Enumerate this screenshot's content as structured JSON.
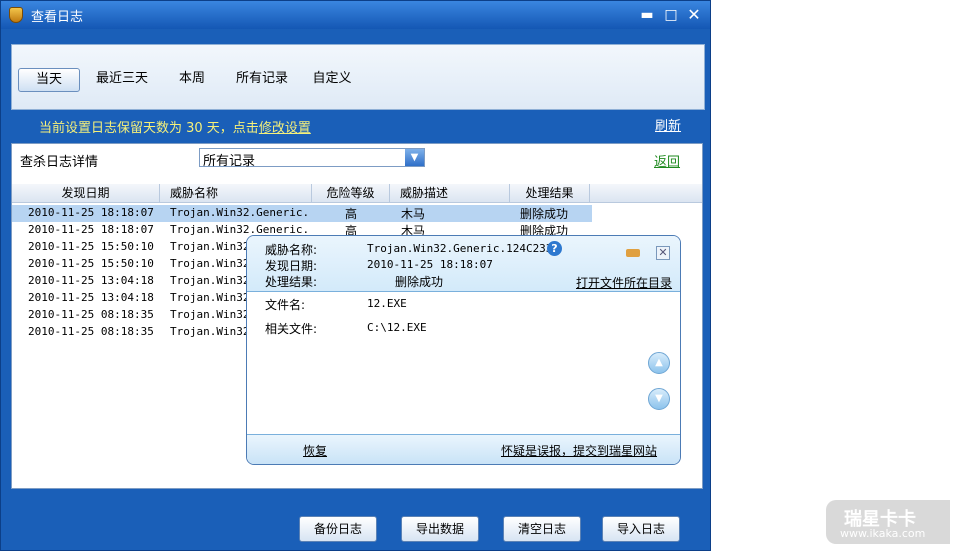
{
  "window": {
    "title": "查看日志",
    "minimize_label": "▬",
    "maximize_label": "□",
    "close_label": "✕"
  },
  "tabs": [
    {
      "label": "当天",
      "active": true
    },
    {
      "label": "最近三天",
      "active": false
    },
    {
      "label": "本周",
      "active": false
    },
    {
      "label": "所有记录",
      "active": false
    },
    {
      "label": "自定义",
      "active": false
    }
  ],
  "notice": {
    "prefix": "当前设置日志保留天数为 30 天，点击",
    "link": "修改设置"
  },
  "refresh_label": "刷新",
  "filter": {
    "label": "查杀日志详情",
    "selected": "所有记录",
    "back_label": "返回"
  },
  "table": {
    "columns": [
      "发现日期",
      "威胁名称",
      "危险等级",
      "威胁描述",
      "处理结果"
    ],
    "rows": [
      {
        "date": "2010-11-25 18:18:07",
        "name": "Trojan.Win32.Generic...",
        "level": "高",
        "desc": "木马",
        "result": "删除成功",
        "selected": true
      },
      {
        "date": "2010-11-25 18:18:07",
        "name": "Trojan.Win32.Generic...",
        "level": "高",
        "desc": "木马",
        "result": "删除成功",
        "selected": false
      },
      {
        "date": "2010-11-25 15:50:10",
        "name": "Trojan.Win32.",
        "level": "",
        "desc": "",
        "result": "",
        "selected": false
      },
      {
        "date": "2010-11-25 15:50:10",
        "name": "Trojan.Win32.",
        "level": "",
        "desc": "",
        "result": "",
        "selected": false
      },
      {
        "date": "2010-11-25 13:04:18",
        "name": "Trojan.Win32.",
        "level": "",
        "desc": "",
        "result": "",
        "selected": false
      },
      {
        "date": "2010-11-25 13:04:18",
        "name": "Trojan.Win32.",
        "level": "",
        "desc": "",
        "result": "",
        "selected": false
      },
      {
        "date": "2010-11-25 08:18:35",
        "name": "Trojan.Win32.",
        "level": "",
        "desc": "",
        "result": "",
        "selected": false
      },
      {
        "date": "2010-11-25 08:18:35",
        "name": "Trojan.Win32.",
        "level": "",
        "desc": "",
        "result": "",
        "selected": false
      }
    ]
  },
  "popup": {
    "threat_name_label": "威胁名称:",
    "threat_name_value": "Trojan.Win32.Generic.124C233F",
    "found_date_label": "发现日期:",
    "found_date_value": "2010-11-25 18:18:07",
    "result_label": "处理结果:",
    "result_value": "删除成功",
    "open_dir_label": "打开文件所在目录",
    "file_name_label": "文件名:",
    "file_name_value": "12.EXE",
    "related_file_label": "相关文件:",
    "related_file_value": "C:\\12.EXE",
    "help_glyph": "?",
    "close_glyph": "✕",
    "scroll_up_glyph": "▲",
    "scroll_down_glyph": "▼",
    "restore_label": "恢复",
    "report_label": "怀疑是误报，提交到瑞星网站"
  },
  "buttons": {
    "backup": "备份日志",
    "export": "导出数据",
    "clear": "清空日志",
    "import": "导入日志"
  },
  "watermark": {
    "main": "瑞星卡卡",
    "sub": "www.ikaka.com"
  },
  "colors": {
    "window_bg": "#1a5fb8",
    "notice_text": "#f5f07a",
    "selected_row": "#b7d4f2",
    "back_link": "#1f8a1f"
  }
}
